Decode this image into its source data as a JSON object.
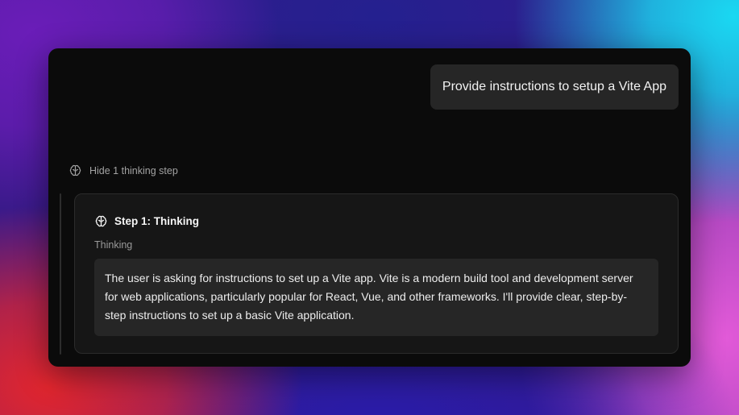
{
  "chat": {
    "user_message": "Provide instructions to setup a Vite App"
  },
  "thinking": {
    "toggle_label": "Hide 1 thinking step",
    "icon": "brain-icon",
    "steps": [
      {
        "title": "Step 1: Thinking",
        "subtitle": "Thinking",
        "content": "The user is asking for instructions to set up a Vite app. Vite is a modern build tool and development server for web applications, particularly popular for React, Vue, and other frameworks. I'll provide clear, step-by-step instructions to set up a basic Vite application."
      }
    ]
  },
  "colors": {
    "window_background": "#0b0b0b",
    "bubble_background": "#262626",
    "card_background": "#161616",
    "muted_text": "#a3a3a3"
  }
}
